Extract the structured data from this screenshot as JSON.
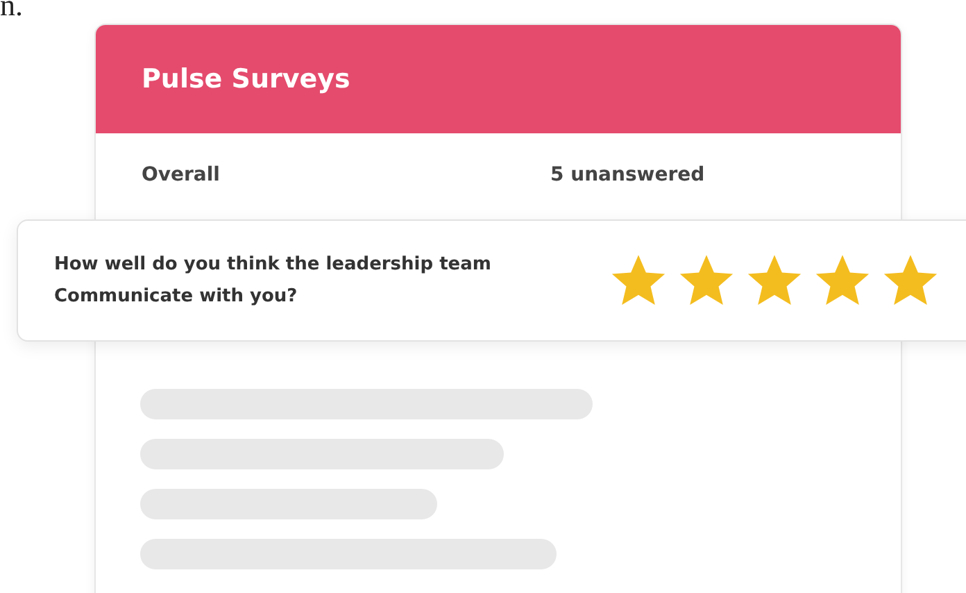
{
  "corner_text": "n.",
  "card": {
    "title": "Pulse Surveys",
    "overall_label": "Overall",
    "unanswered": "5 unanswered"
  },
  "question": {
    "text": "How well do you think the leadership team Communicate with you?",
    "stars": 5
  }
}
